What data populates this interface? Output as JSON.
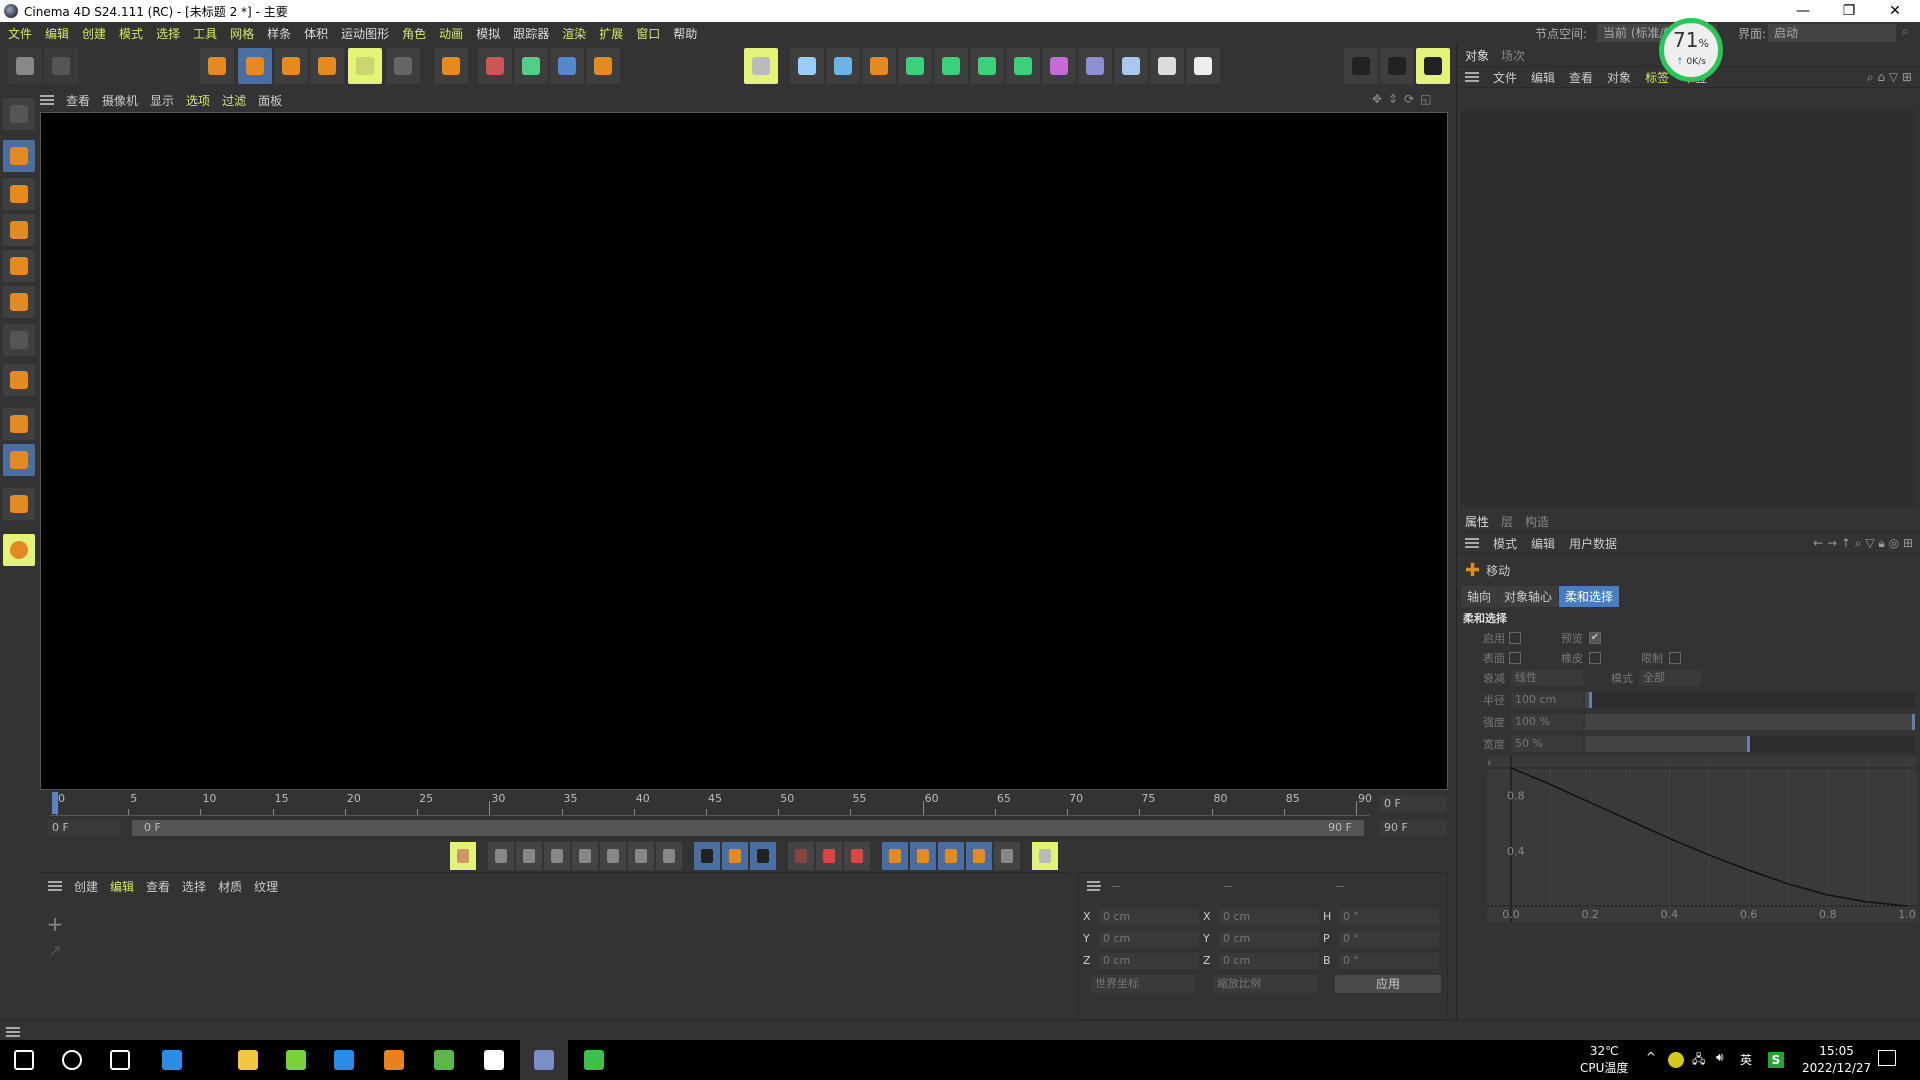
{
  "window": {
    "title": "Cinema 4D S24.111 (RC) - [未标题 2 *] - 主要",
    "min": "—",
    "max": "❐",
    "close": "✕"
  },
  "menu": [
    {
      "label": "文件",
      "hl": true
    },
    {
      "label": "编辑",
      "hl": true
    },
    {
      "label": "创建",
      "hl": true
    },
    {
      "label": "模式",
      "hl": true
    },
    {
      "label": "选择",
      "hl": true
    },
    {
      "label": "工具",
      "hl": true
    },
    {
      "label": "网格",
      "hl": true
    },
    {
      "label": "样条",
      "hl": false
    },
    {
      "label": "体积",
      "hl": false
    },
    {
      "label": "运动图形",
      "hl": false
    },
    {
      "label": "角色",
      "hl": true
    },
    {
      "label": "动画",
      "hl": true
    },
    {
      "label": "模拟",
      "hl": false
    },
    {
      "label": "跟踪器",
      "hl": false
    },
    {
      "label": "渲染",
      "hl": true
    },
    {
      "label": "扩展",
      "hl": true
    },
    {
      "label": "窗口",
      "hl": true
    },
    {
      "label": "帮助",
      "hl": false
    }
  ],
  "nodespace": {
    "label": "节点空间:",
    "value": "当前 (标准/物理)"
  },
  "layout": {
    "label": "界面:",
    "value": "启动"
  },
  "gauge": {
    "percent": "71",
    "unit": "%",
    "speed": "0K/s"
  },
  "toolbar": [
    {
      "name": "undo-icon",
      "color": "#888"
    },
    {
      "name": "redo-icon",
      "color": "#555"
    },
    {
      "name": "live-selection-icon",
      "color": "#e48a22"
    },
    {
      "name": "move-icon",
      "color": "#e48a22",
      "state": "blue"
    },
    {
      "name": "rotate-icon",
      "color": "#e48a22"
    },
    {
      "name": "scale-icon",
      "color": "#e48a22"
    },
    {
      "name": "transform-icon",
      "color": "#c9d86a",
      "state": "yel"
    },
    {
      "name": "coordinate-system-icon",
      "color": "#666"
    },
    {
      "name": "axis-move-icon",
      "color": "#e48a22"
    },
    {
      "name": "x-axis-icon",
      "color": "#c55"
    },
    {
      "name": "y-axis-icon",
      "color": "#5c8"
    },
    {
      "name": "z-axis-icon",
      "color": "#58c"
    },
    {
      "name": "world-coords-icon",
      "color": "#e48a22"
    },
    {
      "name": "render-region-icon",
      "color": "#bbb",
      "state": "yel"
    },
    {
      "name": "null-object-icon",
      "color": "#9cf"
    },
    {
      "name": "cube-icon",
      "color": "#6ab4e8"
    },
    {
      "name": "pen-spline-icon",
      "color": "#e48a22"
    },
    {
      "name": "subdivision-icon",
      "color": "#3ecf7a"
    },
    {
      "name": "extrude-icon",
      "color": "#3ecf7a"
    },
    {
      "name": "cloner-icon",
      "color": "#3ecf7a"
    },
    {
      "name": "mograph-cubes-icon",
      "color": "#3ecf7a"
    },
    {
      "name": "deformer-icon",
      "color": "#c56ad6"
    },
    {
      "name": "field-icon",
      "color": "#8a8fd6"
    },
    {
      "name": "floor-icon",
      "color": "#a8c8ee"
    },
    {
      "name": "camera-icon",
      "color": "#ddd"
    },
    {
      "name": "light-icon",
      "color": "#eee"
    },
    {
      "name": "render-view-icon",
      "color": "#222"
    },
    {
      "name": "render-picture-viewer-icon",
      "color": "#222"
    },
    {
      "name": "render-settings-icon",
      "color": "#222",
      "state": "yel"
    }
  ],
  "viewport_menu": [
    {
      "label": "查看",
      "hl": false
    },
    {
      "label": "摄像机",
      "hl": false
    },
    {
      "label": "显示",
      "hl": false
    },
    {
      "label": "选项",
      "hl": true
    },
    {
      "label": "过滤",
      "hl": true
    },
    {
      "label": "面板",
      "hl": false
    }
  ],
  "lefttools": [
    {
      "name": "make-editable-icon"
    },
    {
      "name": "model-mode-icon",
      "state": "blue"
    },
    {
      "name": "texture-mode-icon"
    },
    {
      "name": "point-mode-icon"
    },
    {
      "name": "edge-mode-icon"
    },
    {
      "name": "polygon-mode-icon"
    },
    {
      "name": "uv-mode-icon"
    },
    {
      "name": "axis-mode-icon"
    },
    {
      "name": "workplane-icon"
    },
    {
      "name": "locked-workplane-icon",
      "state": "blue"
    },
    {
      "name": "snap-icon"
    },
    {
      "name": "solo-icon",
      "state": "yel"
    }
  ],
  "objmanager": {
    "tabs": [
      {
        "label": "对象",
        "active": true
      },
      {
        "label": "场次",
        "active": false
      }
    ],
    "menu": [
      {
        "label": "文件",
        "hl": false
      },
      {
        "label": "编辑",
        "hl": false
      },
      {
        "label": "查看",
        "hl": false
      },
      {
        "label": "对象",
        "hl": false
      },
      {
        "label": "标签",
        "hl": true
      },
      {
        "label": "书签",
        "hl": false
      }
    ]
  },
  "attributes": {
    "tabs": [
      {
        "label": "属性",
        "active": true
      },
      {
        "label": "层",
        "active": false
      },
      {
        "label": "构造",
        "active": false
      }
    ],
    "menu": [
      "模式",
      "编辑",
      "用户数据"
    ],
    "tool": "移动",
    "subtabs": [
      {
        "label": "轴向",
        "active": false
      },
      {
        "label": "对象轴心",
        "active": false
      },
      {
        "label": "柔和选择",
        "active": true
      }
    ],
    "section": "柔和选择",
    "enable": {
      "label": "启用",
      "checked": false
    },
    "preview": {
      "label": "预览",
      "checked": true
    },
    "surface": {
      "label": "表面",
      "checked": false
    },
    "rubber": {
      "label": "橡皮",
      "checked": false
    },
    "restrict": {
      "label": "限制",
      "checked": false
    },
    "falloff": {
      "label": "衰减",
      "value": "线性"
    },
    "mode": {
      "label": "模式",
      "value": "全部"
    },
    "radius": {
      "label": "半径",
      "value": "100 cm",
      "fraction": 0.02
    },
    "strength": {
      "label": "强度",
      "value": "100 %",
      "fraction": 1.0
    },
    "width": {
      "label": "宽度",
      "value": "50 %",
      "fraction": 0.5
    },
    "curve": {
      "xticks": [
        "0.0",
        "0.2",
        "0.4",
        "0.6",
        "0.8",
        "1.0"
      ],
      "yticks": [
        "0.8",
        "0.4"
      ],
      "points": [
        [
          0,
          1
        ],
        [
          0.1,
          0.88
        ],
        [
          0.2,
          0.75
        ],
        [
          0.3,
          0.62
        ],
        [
          0.4,
          0.49
        ],
        [
          0.5,
          0.37
        ],
        [
          0.6,
          0.26
        ],
        [
          0.7,
          0.16
        ],
        [
          0.8,
          0.08
        ],
        [
          0.9,
          0.03
        ],
        [
          1,
          0
        ]
      ]
    }
  },
  "timeline": {
    "ticks": [
      "0",
      "5",
      "10",
      "15",
      "20",
      "25",
      "30",
      "35",
      "40",
      "45",
      "50",
      "55",
      "60",
      "65",
      "70",
      "75",
      "80",
      "85",
      "90"
    ],
    "current": "0 F",
    "start": "0 F",
    "range_start": "0 F",
    "range_end": "90 F",
    "end": "90 F"
  },
  "transport": [
    {
      "name": "keyframe-icon",
      "state": "yel",
      "color": "#c96"
    },
    {
      "name": "go-to-start-icon",
      "color": "#888"
    },
    {
      "name": "prev-key-icon",
      "color": "#888"
    },
    {
      "name": "prev-frame-icon",
      "color": "#888"
    },
    {
      "name": "play-icon",
      "color": "#888"
    },
    {
      "name": "next-frame-icon",
      "color": "#888"
    },
    {
      "name": "next-key-icon",
      "color": "#888"
    },
    {
      "name": "go-to-end-icon",
      "color": "#888"
    },
    {
      "name": "loop-icon",
      "state": "blue",
      "color": "#222"
    },
    {
      "name": "range-icon",
      "state": "blue",
      "color": "#e48a22"
    },
    {
      "name": "sound-icon",
      "state": "blue",
      "color": "#222"
    },
    {
      "name": "record-icon",
      "color": "#844"
    },
    {
      "name": "autokey-icon",
      "color": "#d44"
    },
    {
      "name": "keyframe-selection-icon",
      "color": "#d44"
    },
    {
      "name": "key-position-icon",
      "state": "blue",
      "color": "#e48a22"
    },
    {
      "name": "key-rotation-icon",
      "state": "blue",
      "color": "#e48a22"
    },
    {
      "name": "key-scale-icon",
      "state": "blue",
      "color": "#e48a22"
    },
    {
      "name": "key-param-icon",
      "state": "blue",
      "color": "#e48a22"
    },
    {
      "name": "key-pla-icon",
      "color": "#888"
    },
    {
      "name": "motion-system-icon",
      "state": "yel",
      "color": "#bbb"
    }
  ],
  "material": {
    "menu": [
      {
        "label": "创建",
        "hl": false
      },
      {
        "label": "编辑",
        "hl": true
      },
      {
        "label": "查看",
        "hl": false
      },
      {
        "label": "选择",
        "hl": false
      },
      {
        "label": "材质",
        "hl": false
      },
      {
        "label": "纹理",
        "hl": false
      }
    ]
  },
  "coords": {
    "headers": [
      "--",
      "--",
      "--"
    ],
    "rows": [
      {
        "a": "X",
        "av": "0 cm",
        "b": "X",
        "bv": "0 cm",
        "c": "H",
        "cv": "0 °"
      },
      {
        "a": "Y",
        "av": "0 cm",
        "b": "Y",
        "bv": "0 cm",
        "c": "P",
        "cv": "0 °"
      },
      {
        "a": "Z",
        "av": "0 cm",
        "b": "Z",
        "bv": "0 cm",
        "c": "B",
        "cv": "0 °"
      }
    ],
    "space": "世界坐标",
    "scale": "缩放比例",
    "apply": "应用"
  },
  "taskbar": {
    "apps": [
      {
        "name": "start-icon",
        "color": "#fff"
      },
      {
        "name": "search-circle-icon",
        "color": "#fff"
      },
      {
        "name": "fan-app-icon",
        "color": "#fff"
      },
      {
        "name": "ie-browser-icon",
        "color": "#2a8de6"
      },
      {
        "name": "file-explorer-icon",
        "color": "#f3c640"
      },
      {
        "name": "green-browser-icon",
        "color": "#7ad23a"
      },
      {
        "name": "qq-browser-icon",
        "color": "#2a8de6"
      },
      {
        "name": "illustrator-icon",
        "color": "#e8821e"
      },
      {
        "name": "coreldraw-icon",
        "color": "#5cb848"
      },
      {
        "name": "calculator-icon",
        "color": "#fff"
      },
      {
        "name": "cinema4d-icon",
        "color": "#7a8fc8",
        "active": true
      },
      {
        "name": "wechat-icon",
        "color": "#3ec14a"
      }
    ],
    "temp": "32℃",
    "temp_label": "CPU温度",
    "ime": "英",
    "time": "15:05",
    "date": "2022/12/27"
  }
}
